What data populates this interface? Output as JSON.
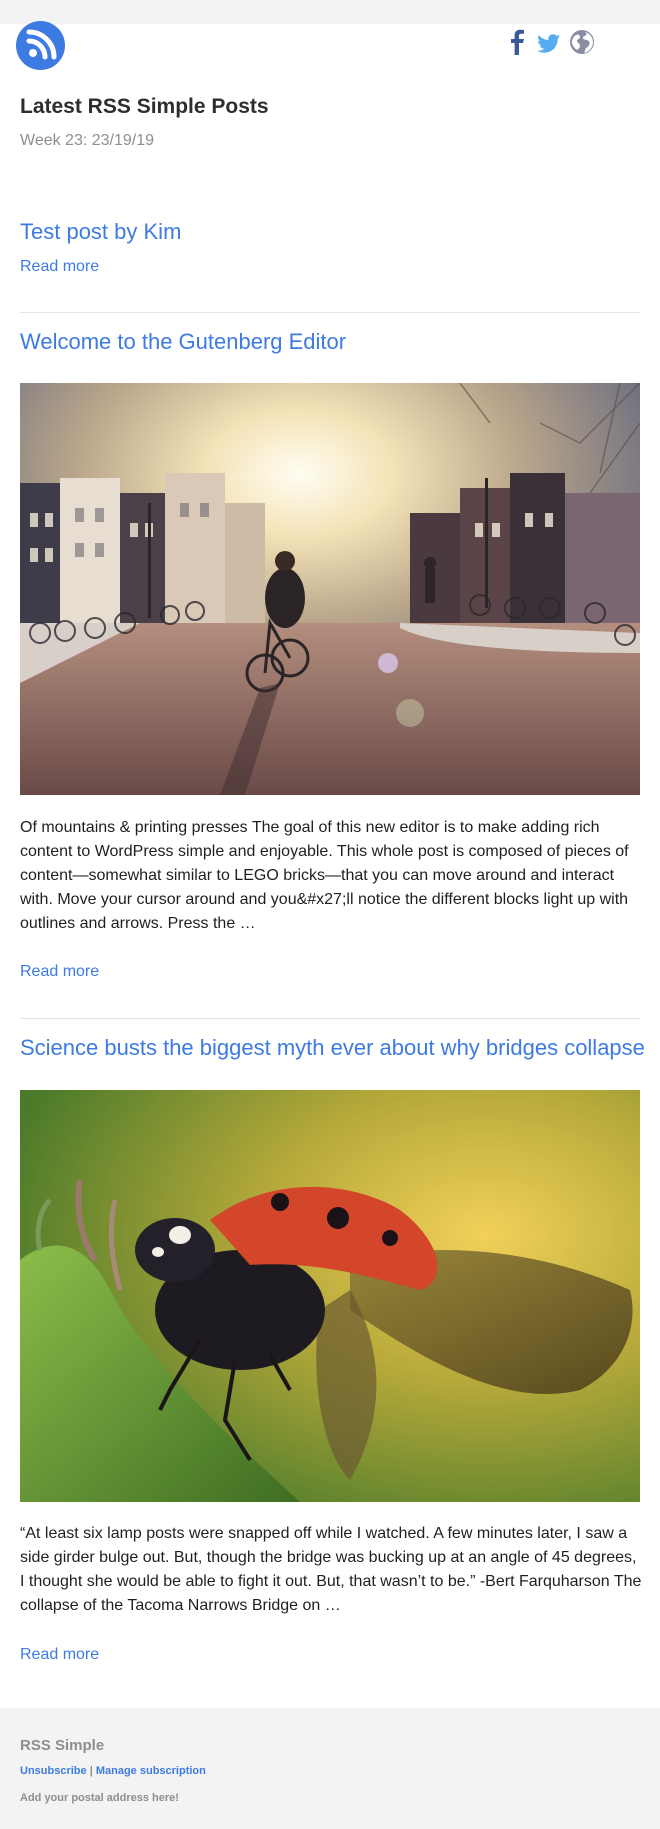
{
  "header": {
    "logo_icon": "rss-icon",
    "social_icons": [
      "facebook-icon",
      "twitter-icon",
      "globe-icon"
    ],
    "title": "Latest RSS Simple Posts",
    "subtitle": "Week 23: 23/19/19"
  },
  "posts": [
    {
      "title": "Test post by Kim",
      "read_more": "Read more"
    },
    {
      "title": "Welcome to the Gutenberg Editor",
      "image": "city-cyclist-photo",
      "excerpt": "Of mountains & printing presses The goal of this new editor is to make adding rich content to WordPress simple and enjoyable. This whole post is composed of pieces of content—somewhat similar to LEGO bricks—that you can move around and interact with. Move your cursor around and you&#x27;ll notice the different blocks light up with outlines and arrows. Press the …",
      "read_more": "Read more"
    },
    {
      "title": "Science busts the biggest myth ever about why bridges collapse",
      "image": "ladybug-photo",
      "excerpt": "“At least six lamp posts were snapped off while I watched. A few minutes later, I saw a side girder bulge out. But, though the bridge was bucking up at an angle of 45 degrees, I thought she would be able to fight it out. But, that wasn’t to be.” -Bert Farquharson The collapse of the Tacoma Narrows Bridge on …",
      "read_more": "Read more"
    }
  ],
  "footer": {
    "name": "RSS Simple",
    "unsubscribe": "Unsubscribe",
    "separator": "|",
    "manage": "Manage subscription",
    "address": "Add your postal address here!"
  },
  "colors": {
    "accent": "#3d7be2",
    "background": "#f3f3f3",
    "card": "#ffffff",
    "muted_text": "#8e8e8e",
    "facebook": "#3b5a9a",
    "twitter": "#55acee",
    "globe": "#8a8da3"
  }
}
